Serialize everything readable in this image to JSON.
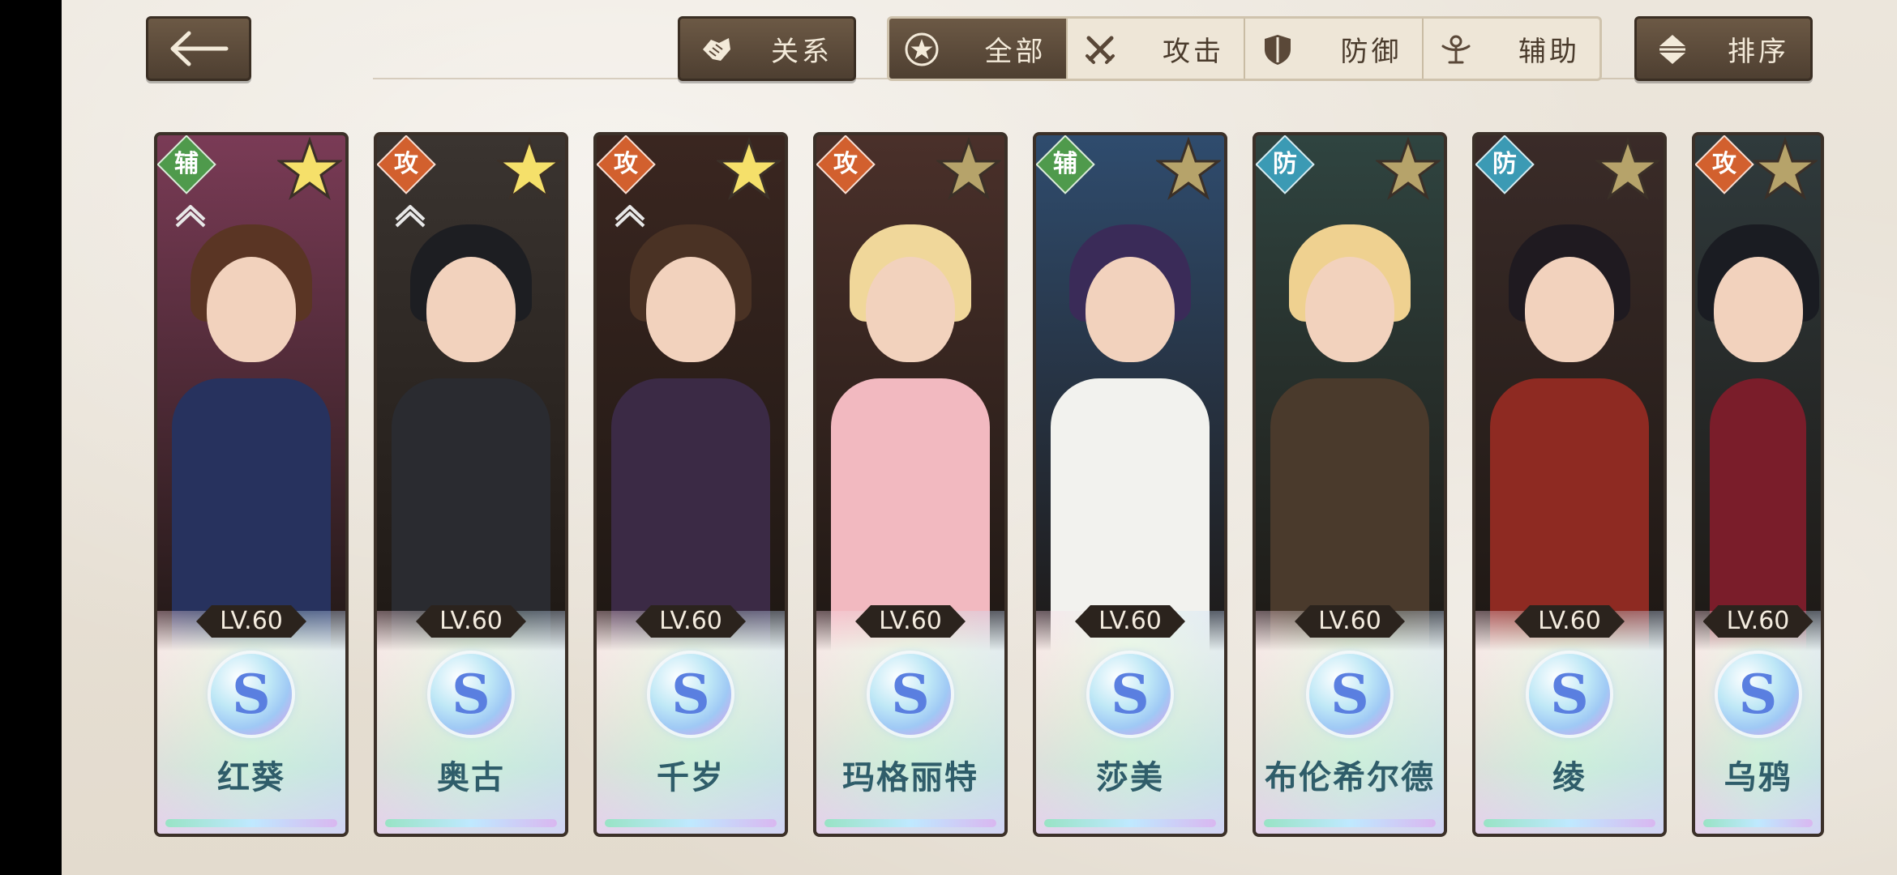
{
  "nav": {
    "relations_label": "关系",
    "sort_label": "排序"
  },
  "filters": [
    {
      "label": "全部",
      "icon": "star-circle-icon",
      "active": true
    },
    {
      "label": "攻击",
      "icon": "crossed-swords-icon",
      "active": false
    },
    {
      "label": "防御",
      "icon": "shield-icon",
      "active": false
    },
    {
      "label": "辅助",
      "icon": "support-figure-icon",
      "active": false
    }
  ],
  "characters": [
    {
      "name": "红葵",
      "role": "辅",
      "role_type": "support",
      "level": "LV.60",
      "rank": "S",
      "star_color": "#f5e06a",
      "locked": true,
      "palette": {
        "bg": "#7a3b56",
        "hair": "#5a3524",
        "body": "#27325e"
      }
    },
    {
      "name": "奥古",
      "role": "攻",
      "role_type": "attack",
      "level": "LV.60",
      "rank": "S",
      "star_color": "#f5e06a",
      "locked": true,
      "palette": {
        "bg": "#3a3430",
        "hair": "#1d1e22",
        "body": "#2a2b30"
      }
    },
    {
      "name": "千岁",
      "role": "攻",
      "role_type": "attack",
      "level": "LV.60",
      "rank": "S",
      "star_color": "#f5e06a",
      "locked": true,
      "palette": {
        "bg": "#3a2620",
        "hair": "#4a3224",
        "body": "#3b2a45"
      }
    },
    {
      "name": "玛格丽特",
      "role": "攻",
      "role_type": "attack",
      "level": "LV.60",
      "rank": "S",
      "star_color": "#b6a36a",
      "locked": false,
      "palette": {
        "bg": "#4a302a",
        "hair": "#f0d79a",
        "body": "#f2b9c0"
      }
    },
    {
      "name": "莎美",
      "role": "辅",
      "role_type": "support",
      "level": "LV.60",
      "rank": "S",
      "star_color": "#b6a36a",
      "locked": false,
      "palette": {
        "bg": "#2f4c6e",
        "hair": "#3a2b58",
        "body": "#f2f2ee"
      }
    },
    {
      "name": "布伦希尔德",
      "role": "防",
      "role_type": "defense",
      "level": "LV.60",
      "rank": "S",
      "star_color": "#b6a36a",
      "locked": false,
      "palette": {
        "bg": "#2f4440",
        "hair": "#efd190",
        "body": "#4a3a2c"
      }
    },
    {
      "name": "绫",
      "role": "防",
      "role_type": "defense",
      "level": "LV.60",
      "rank": "S",
      "star_color": "#b6a36a",
      "locked": false,
      "palette": {
        "bg": "#3a2b28",
        "hair": "#1f1a20",
        "body": "#8e2a22"
      }
    },
    {
      "name": "乌鸦",
      "role": "攻",
      "role_type": "attack",
      "level": "LV.60",
      "rank": "S",
      "star_color": "#b6a36a",
      "locked": false,
      "palette": {
        "bg": "#2f3a3c",
        "hair": "#1a1c22",
        "body": "#7a1d2a"
      }
    }
  ]
}
